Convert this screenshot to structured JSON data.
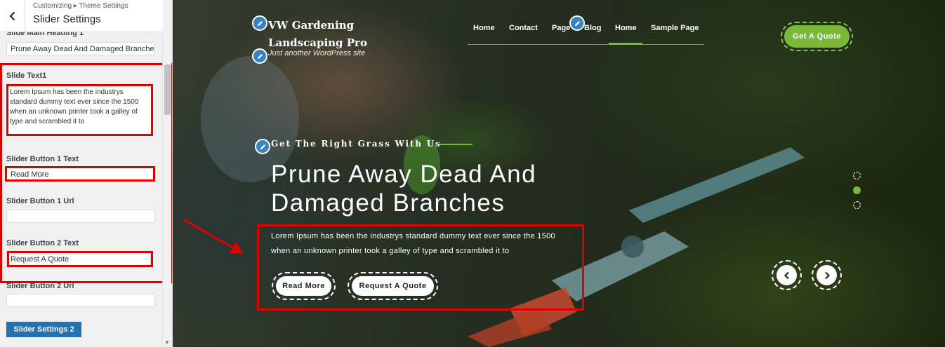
{
  "customizer": {
    "breadcrumb": "Customizing ▸ Theme Settings",
    "title": "Slider Settings",
    "fields": {
      "main_heading_label": "Slide Main Heading 1",
      "main_heading_value": "Prune Away Dead And Damaged Branches",
      "text_label": "Slide Text1",
      "text_value": "Lorem Ipsum has been the industrys standard dummy text ever since the 1500 when an unknown printer took a galley of type and scrambled it to",
      "btn1_text_label": "Slider Button 1 Text",
      "btn1_text_value": "Read More",
      "btn1_url_label": "Slider Button 1 Url",
      "btn1_url_value": "",
      "btn2_text_label": "Slider Button 2 Text",
      "btn2_text_value": "Request A Quote",
      "btn2_url_label": "Slider Button 2 Url",
      "btn2_url_value": ""
    },
    "next_section_button": "Slider Settings 2"
  },
  "site": {
    "title": "VW Gardening Landscaping Pro",
    "tagline": "Just another WordPress site",
    "nav": [
      "Home",
      "Contact",
      "Page",
      "Blog",
      "Home",
      "Sample Page"
    ],
    "active_nav_index": 4,
    "quote_button": "Get A Quote"
  },
  "slide": {
    "eyebrow": "Get The Right Grass With Us",
    "headline": "Prune Away Dead And Damaged Branches",
    "description": "Lorem Ipsum has been the industrys standard dummy text ever since the 1500 when an unknown printer took a galley of type and scrambled it to",
    "button1": "Read More",
    "button2": "Request A Quote",
    "slide_count": 3,
    "active_slide": 2
  },
  "colors": {
    "accent_green": "#7ab83a",
    "annotation_red": "#e00000",
    "wp_blue": "#2271b1"
  },
  "icons": [
    "back-arrow-icon",
    "pencil-icon",
    "chevron-left-icon",
    "chevron-right-icon"
  ]
}
